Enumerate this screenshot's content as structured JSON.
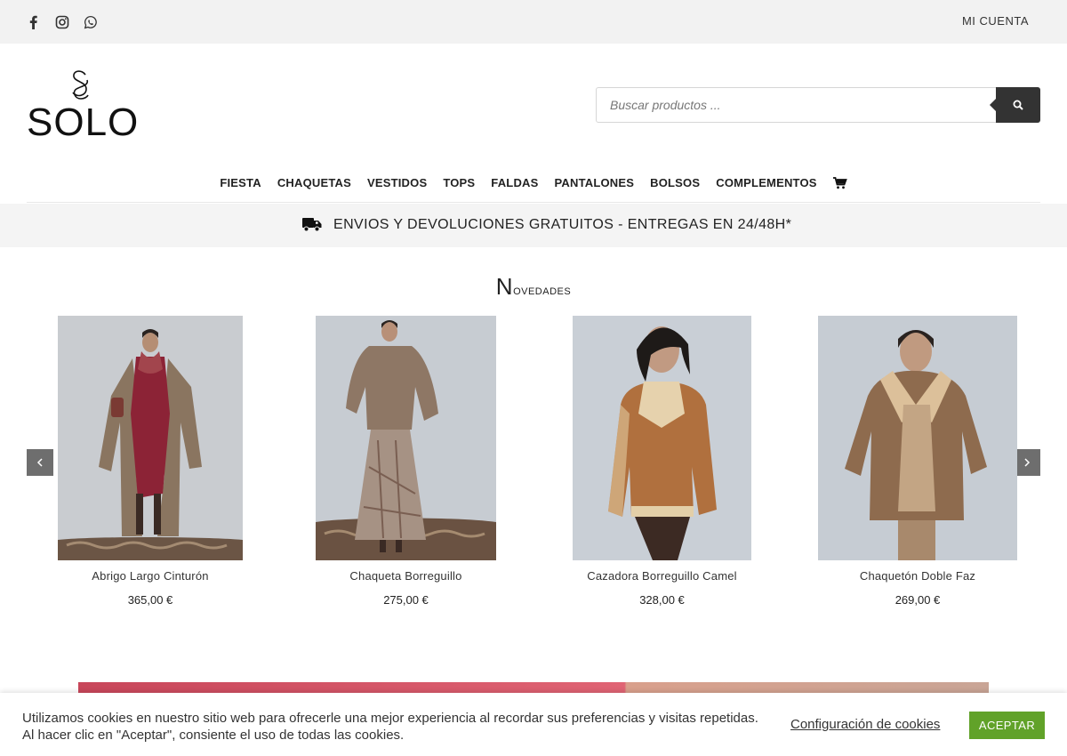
{
  "topbar": {
    "social": [
      "facebook-icon",
      "instagram-icon",
      "whatsapp-icon"
    ],
    "account_label": "MI CUENTA"
  },
  "logo": {
    "text": "SOLO"
  },
  "search": {
    "placeholder": "Buscar productos ..."
  },
  "nav": {
    "items": [
      "FIESTA",
      "CHAQUETAS",
      "VESTIDOS",
      "TOPS",
      "FALDAS",
      "PANTALONES",
      "BOLSOS",
      "COMPLEMENTOS"
    ],
    "cart_icon": "cart-icon"
  },
  "banner": {
    "icon": "truck-icon",
    "text": "ENVIOS Y DEVOLUCIONES GRATUITOS - ENTREGAS EN 24/48H*"
  },
  "section": {
    "title_first": "N",
    "title_rest": "ovedades"
  },
  "products": [
    {
      "name": "Abrigo Largo Cinturón",
      "price": "365,00 €"
    },
    {
      "name": "Chaqueta Borreguillo",
      "price": "275,00 €"
    },
    {
      "name": "Cazadora Borreguillo Camel",
      "price": "328,00 €"
    },
    {
      "name": "Chaquetón Doble Faz",
      "price": "269,00 €"
    }
  ],
  "colors": {
    "accept_green": "#61a229",
    "dark": "#333333",
    "topbar_bg": "#f2f2f2"
  },
  "cookie": {
    "text": "Utilizamos cookies en nuestro sitio web para ofrecerle una mejor experiencia al recordar sus preferencias y visitas repetidas. Al hacer clic en \"Aceptar\", consiente el uso de todas las cookies.",
    "config_label": "Configuración de cookies",
    "accept_label": "ACEPTAR"
  }
}
